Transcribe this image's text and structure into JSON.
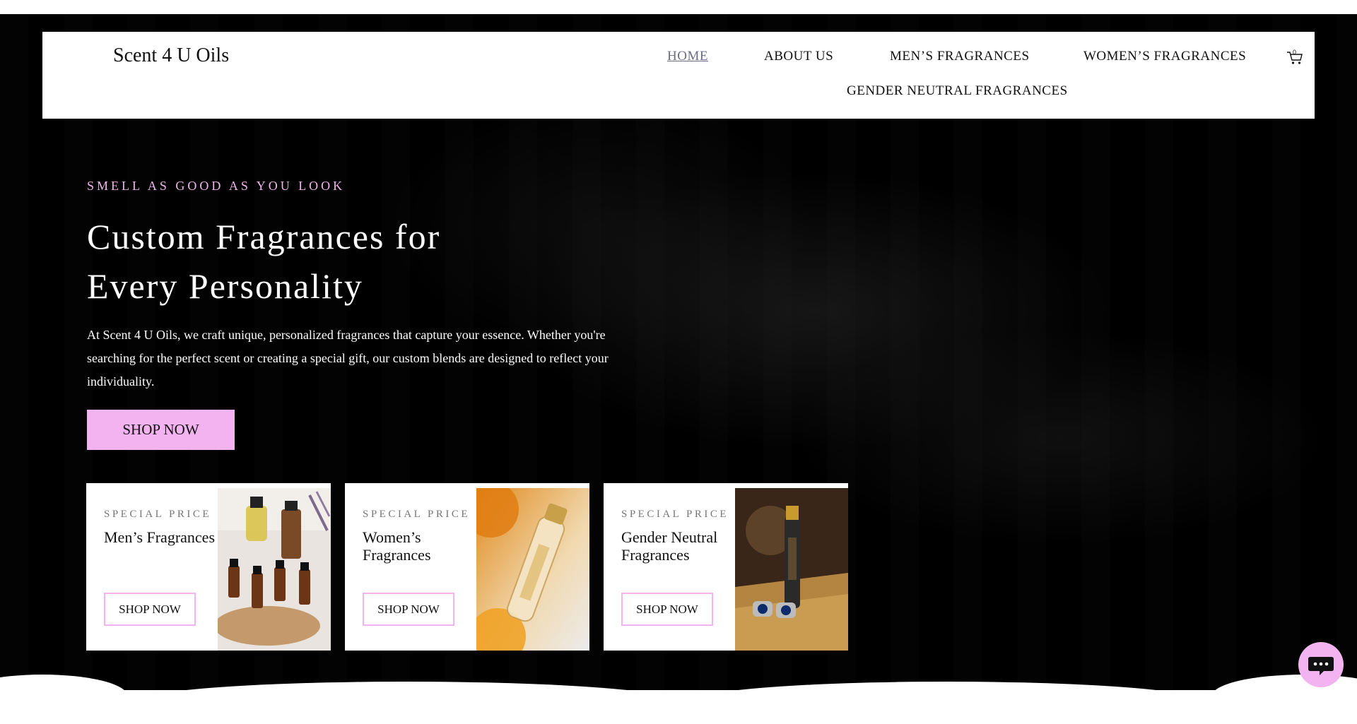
{
  "header": {
    "logo": "Scent 4 U Oils",
    "nav": [
      {
        "label": "HOME",
        "active": true
      },
      {
        "label": "ABOUT US"
      },
      {
        "label": "MEN’S FRAGRANCES"
      },
      {
        "label": "WOMEN’S FRAGRANCES"
      },
      {
        "label": "GENDER NEUTRAL FRAGRANCES"
      }
    ],
    "cart_count": "0",
    "cart_icon": "cart-icon"
  },
  "hero": {
    "eyebrow": "SMELL AS GOOD AS YOU LOOK",
    "title_line1": "Custom Fragrances for",
    "title_line2": "Every Personality",
    "text": "At Scent 4 U Oils, we craft unique, personalized fragrances that capture your essence. Whether you're searching for the perfect scent or creating a special gift, our custom blends are designed to reflect your individuality.",
    "button": "SHOP NOW"
  },
  "cards": [
    {
      "eyebrow": "SPECIAL PRICE",
      "title": "Men’s Fragrances",
      "button": "SHOP NOW"
    },
    {
      "eyebrow": "SPECIAL PRICE",
      "title": "Women’s Fragrances",
      "button": "SHOP NOW"
    },
    {
      "eyebrow": "SPECIAL PRICE",
      "title": "Gender Neutral Fragrances",
      "button": "SHOP NOW"
    }
  ],
  "chat": {
    "icon": "chat-bubble-icon"
  },
  "colors": {
    "accent_pink": "#f3b3f0",
    "background": "#000000",
    "nav_active": "#6a6d86"
  }
}
